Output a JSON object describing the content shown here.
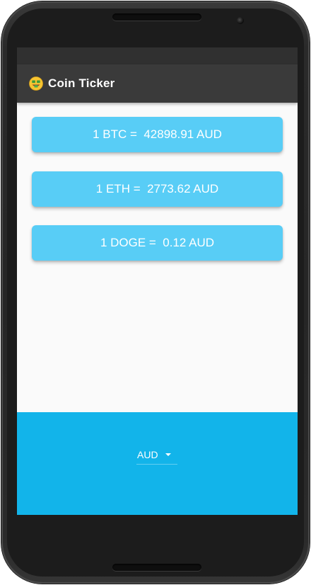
{
  "app_bar": {
    "icon": "money-mouth-face-icon",
    "title": "Coin Ticker"
  },
  "rates": [
    {
      "text": "1 BTC =  42898.91 AUD"
    },
    {
      "text": "1 ETH =  2773.62 AUD"
    },
    {
      "text": "1 DOGE =  0.12 AUD"
    }
  ],
  "currency_picker": {
    "selected": "AUD",
    "icon": "chevron-down-icon"
  },
  "colors": {
    "app_bar": "#3a3a3a",
    "card": "#58cdf6",
    "bottom_panel": "#12b4ea",
    "background": "#fafafa"
  }
}
